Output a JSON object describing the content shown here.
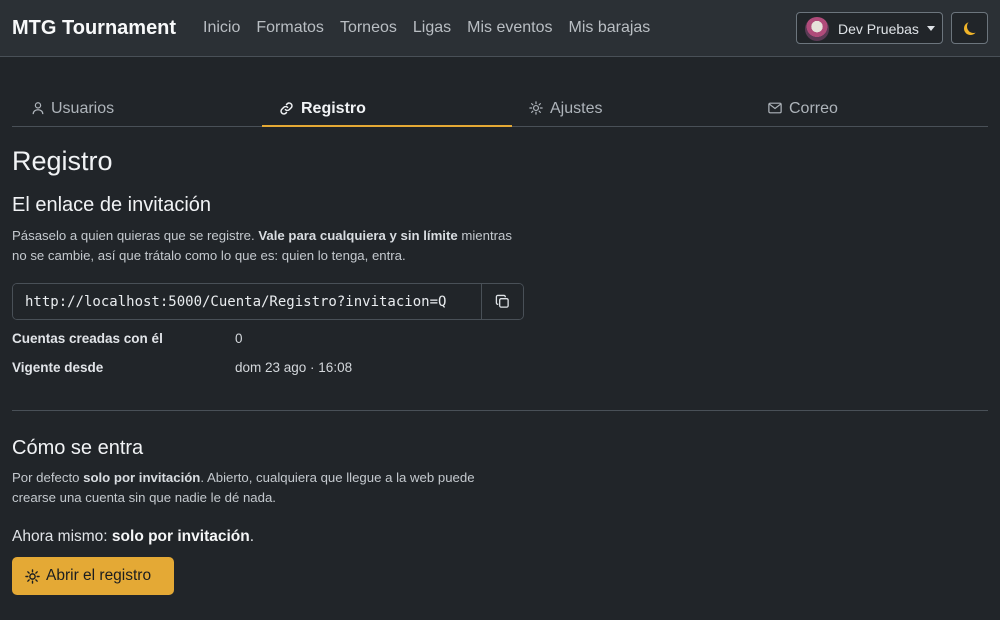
{
  "navbar": {
    "brand": "MTG Tournament",
    "links": [
      "Inicio",
      "Formatos",
      "Torneos",
      "Ligas",
      "Mis eventos",
      "Mis barajas"
    ],
    "user_name": "Dev Pruebas",
    "theme_icon": "moon-icon"
  },
  "tabs": [
    {
      "label": "Usuarios",
      "icon": "user-icon",
      "active": false
    },
    {
      "label": "Registro",
      "icon": "link-icon",
      "active": true
    },
    {
      "label": "Ajustes",
      "icon": "sun-gear-icon",
      "active": false
    },
    {
      "label": "Correo",
      "icon": "envelope-icon",
      "active": false
    }
  ],
  "page_title": "Registro",
  "invite": {
    "heading": "El enlace de invitación",
    "desc_1": "Pásaselo a quien quieras que se registre. ",
    "desc_bold": "Vale para cualquiera y sin límite",
    "desc_2": " mientras no se cambie, así que trátalo como lo que es: quien lo tenga, entra.",
    "link_value": "http://localhost:5000/Cuenta/Registro?invitacion=Q",
    "copy_icon": "copy-icon",
    "accounts_label": "Cuentas creadas con él",
    "accounts_value": "0",
    "since_label": "Vigente desde",
    "since_value": "dom 23 ago · 16:08"
  },
  "access": {
    "heading": "Cómo se entra",
    "desc_1": "Por defecto ",
    "desc_bold": "solo por invitación",
    "desc_2": ". Abierto, cualquiera que llegue a la web puede crearse una cuenta sin que nadie le dé nada.",
    "now_prefix": "Ahora mismo: ",
    "now_value": "solo por invitación",
    "now_suffix": ".",
    "button_label": "Abrir el registro"
  },
  "colors": {
    "accent": "#e4a935",
    "background": "#212529",
    "navbar": "#2b3035"
  }
}
